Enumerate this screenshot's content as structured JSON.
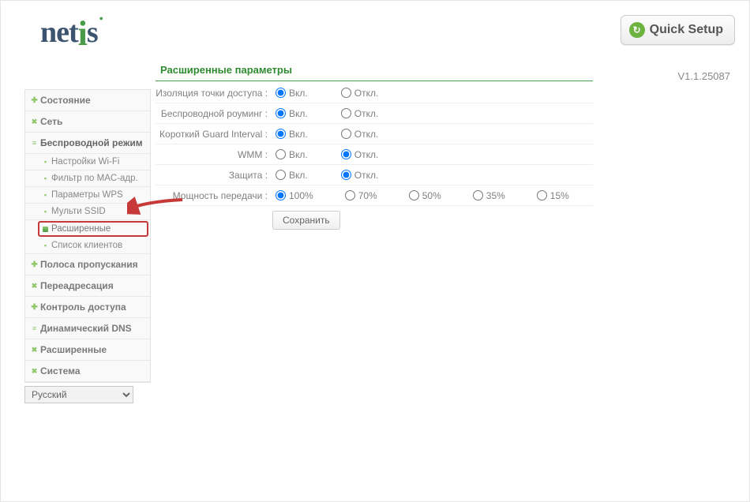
{
  "header": {
    "logo_text": "netis",
    "quick_setup_label": "Quick Setup",
    "version": "V1.1.25087"
  },
  "sidebar": {
    "items": [
      {
        "label": "Состояние",
        "bullet": "plus"
      },
      {
        "label": "Сеть",
        "bullet": "cross"
      },
      {
        "label": "Беспроводной режим",
        "bullet": "eq",
        "open": true,
        "children": [
          {
            "label": "Настройки Wi-Fi",
            "bullet": "sdot"
          },
          {
            "label": "Фильтр по MAC-адр.",
            "bullet": "sdot"
          },
          {
            "label": "Параметры WPS",
            "bullet": "sdot"
          },
          {
            "label": "Мульти SSID",
            "bullet": "sdot"
          },
          {
            "label": "Расширенные",
            "bullet": "sq",
            "active": true
          },
          {
            "label": "Список клиентов",
            "bullet": "sdot"
          }
        ]
      },
      {
        "label": "Полоса пропускания",
        "bullet": "plus"
      },
      {
        "label": "Переадресация",
        "bullet": "cross"
      },
      {
        "label": "Контроль доступа",
        "bullet": "plus"
      },
      {
        "label": "Динамический DNS",
        "bullet": "eq"
      },
      {
        "label": "Расширенные",
        "bullet": "cross"
      },
      {
        "label": "Система",
        "bullet": "cross"
      }
    ],
    "language": "Русский"
  },
  "content": {
    "title": "Расширенные параметры",
    "on": "Вкл.",
    "off": "Откл.",
    "rows": {
      "ap_isolation": "Изоляция точки доступа :",
      "roaming": "Беспроводной роуминг :",
      "short_gi": "Короткий Guard Interval :",
      "wmm": "WMM :",
      "protection": "Защита :",
      "tx_power": "Мощность передачи :"
    },
    "tx_options": [
      "100%",
      "70%",
      "50%",
      "35%",
      "15%"
    ],
    "selections": {
      "ap_isolation": "on",
      "roaming": "on",
      "short_gi": "on",
      "wmm": "off",
      "protection": "off",
      "tx_power": "100%"
    },
    "save_label": "Сохранить"
  }
}
